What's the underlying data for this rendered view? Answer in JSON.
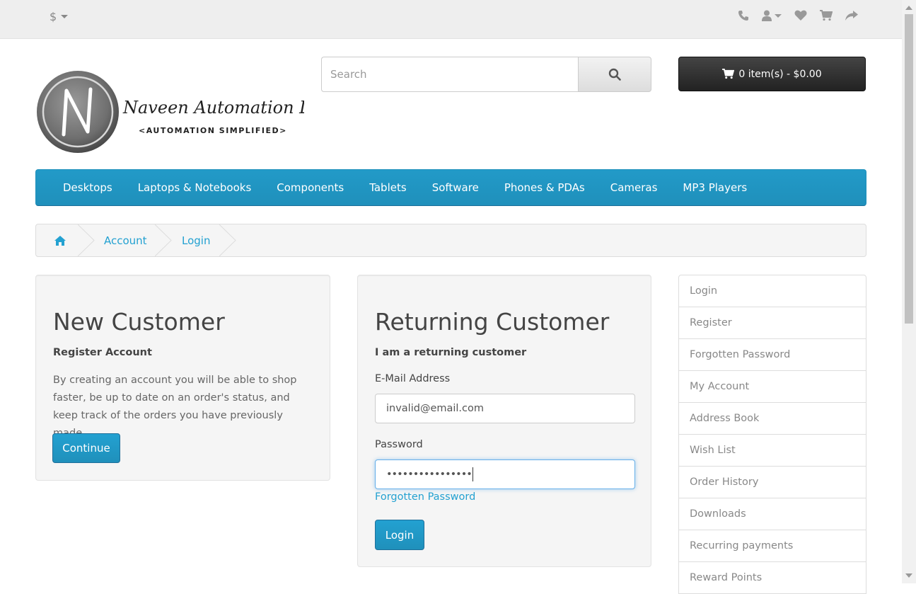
{
  "top_bar": {
    "currency_symbol": "$",
    "icons": [
      "phone-icon",
      "user-icon",
      "heart-icon",
      "shopping-cart-icon",
      "share-icon"
    ]
  },
  "logo": {
    "name": "Naveen Automation Labs",
    "tagline": "<AUTOMATION SIMPLIFIED>"
  },
  "search": {
    "placeholder": "Search"
  },
  "cart": {
    "label": "0 item(s) - $0.00"
  },
  "menu": {
    "items": [
      "Desktops",
      "Laptops & Notebooks",
      "Components",
      "Tablets",
      "Software",
      "Phones & PDAs",
      "Cameras",
      "MP3 Players"
    ]
  },
  "breadcrumb": {
    "items": [
      "Account",
      "Login"
    ]
  },
  "new_customer": {
    "title": "New Customer",
    "subtitle": "Register Account",
    "description": "By creating an account you will be able to shop faster, be up to date on an order's status, and keep track of the orders you have previously made.",
    "button_label": "Continue"
  },
  "returning_customer": {
    "title": "Returning Customer",
    "subtitle": "I am a returning customer",
    "email_label": "E-Mail Address",
    "email_value": "invalid@email.com",
    "password_label": "Password",
    "password_value": "••••••••••••••••",
    "forgotten_link": "Forgotten Password",
    "login_button": "Login"
  },
  "account_links": {
    "items": [
      "Login",
      "Register",
      "Forgotten Password",
      "My Account",
      "Address Book",
      "Wish List",
      "Order History",
      "Downloads",
      "Recurring payments",
      "Reward Points"
    ]
  },
  "colors": {
    "accent": "#229ac8",
    "link": "#23a1d1",
    "cart_bg": "#363636"
  }
}
